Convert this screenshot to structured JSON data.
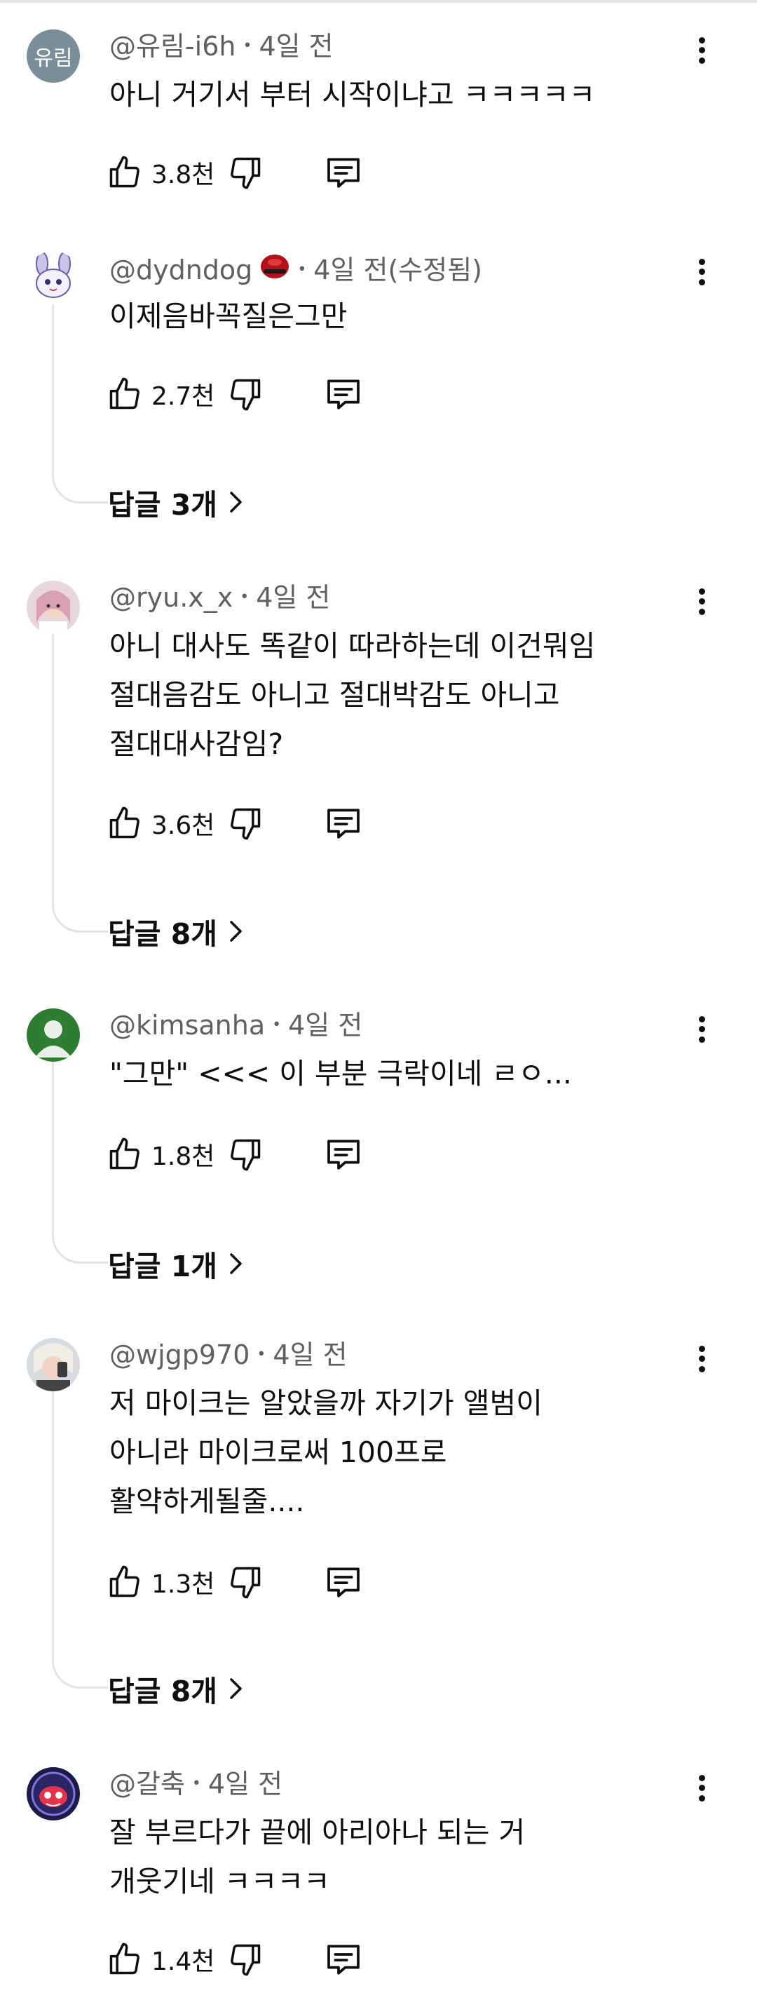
{
  "comments": [
    {
      "avatar_text": "유림",
      "author": "@유림-i6h",
      "time": "4일 전",
      "text": "아니 거기서 부터 시작이냐고 ㅋㅋㅋㅋㅋ",
      "likes": "3.8천"
    },
    {
      "author": "@dydndog",
      "time": "4일 전(수정됨)",
      "text": "이제음바꼭질은그만",
      "likes": "2.7천",
      "replies": "답글 3개"
    },
    {
      "author": "@ryu.x_x",
      "time": "4일 전",
      "text": "아니 대사도 똑같이 따라하는데 이건뭐임\n절대음감도 아니고 절대박감도 아니고\n절대대사감임?",
      "likes": "3.6천",
      "replies": "답글 8개"
    },
    {
      "author": "@kimsanha",
      "time": "4일 전",
      "text": "\"그만\" <<< 이 부분 극락이네 ㄹㅇ...",
      "likes": "1.8천",
      "replies": "답글 1개"
    },
    {
      "author": "@wjgp970",
      "time": "4일 전",
      "text": "저 마이크는 알았을까 자기가 앨범이\n아니라 마이크로써 100프로\n활약하게될줄....",
      "likes": "1.3천",
      "replies": "답글 8개"
    },
    {
      "author": "@갈축",
      "time": "4일 전",
      "text": "잘 부르다가 끝에 아리아나 되는 거\n개웃기네 ㅋㅋㅋㅋ",
      "likes": "1.4천"
    }
  ],
  "icons": {
    "like": "thumbs-up-icon",
    "dislike": "thumbs-down-icon",
    "reply": "reply-icon",
    "more": "more-vert-icon",
    "chevron": "chevron-right-icon"
  },
  "colors": {
    "text": "#0f0f0f",
    "meta": "#606060",
    "thread_line": "#e3e3e3"
  }
}
